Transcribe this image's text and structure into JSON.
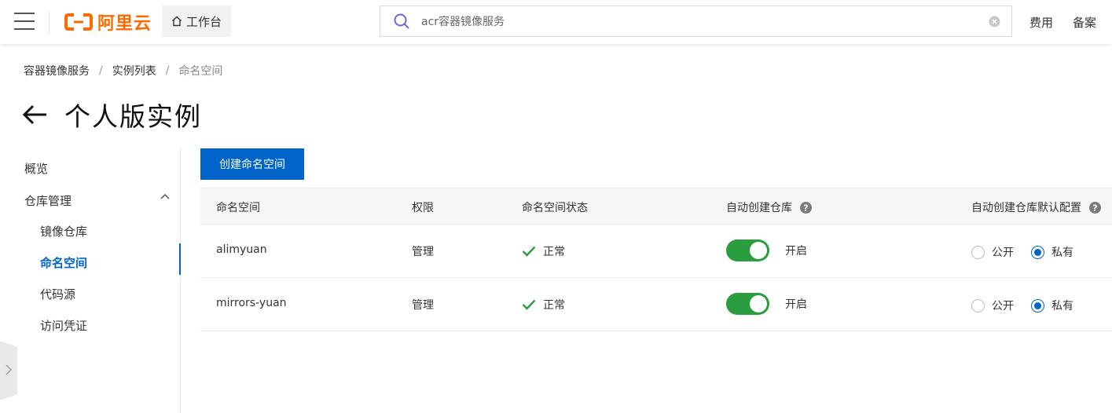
{
  "topbar": {
    "brand": "阿里云",
    "workbench_label": "工作台",
    "search_value": "acr容器镜像服务",
    "links": [
      "费用",
      "备案"
    ]
  },
  "breadcrumb": [
    "容器镜像服务",
    "实例列表",
    "命名空间"
  ],
  "page_title": "个人版实例",
  "sidenav": {
    "items": [
      {
        "label": "概览"
      },
      {
        "label": "仓库管理"
      },
      {
        "label": "镜像仓库"
      },
      {
        "label": "命名空间",
        "active": true
      },
      {
        "label": "代码源"
      },
      {
        "label": "访问凭证"
      }
    ]
  },
  "create_button": "创建命名空间",
  "table": {
    "headers": [
      "命名空间",
      "权限",
      "命名空间状态",
      "自动创建仓库",
      "自动创建仓库默认配置"
    ],
    "rows": [
      {
        "namespace": "alimyuan",
        "permission": "管理",
        "status": "正常",
        "auto_create": "开启",
        "auto_create_on": true,
        "public_label": "公开",
        "private_label": "私有",
        "default": "私有"
      },
      {
        "namespace": "mirrors-yuan",
        "permission": "管理",
        "status": "正常",
        "auto_create": "开启",
        "auto_create_on": true,
        "public_label": "公开",
        "private_label": "私有",
        "default": "私有"
      }
    ]
  },
  "colors": {
    "accent": "#0064c8",
    "brand": "#ff6a00",
    "switch_on": "#2a9d3f",
    "status_ok": "#2a9d3f"
  },
  "icons": [
    "menu-icon",
    "aliyun-logo-icon",
    "home-icon",
    "search-icon",
    "clear-icon",
    "back-arrow-icon",
    "chevron-up-icon",
    "help-icon",
    "check-icon",
    "chevron-right-icon"
  ]
}
